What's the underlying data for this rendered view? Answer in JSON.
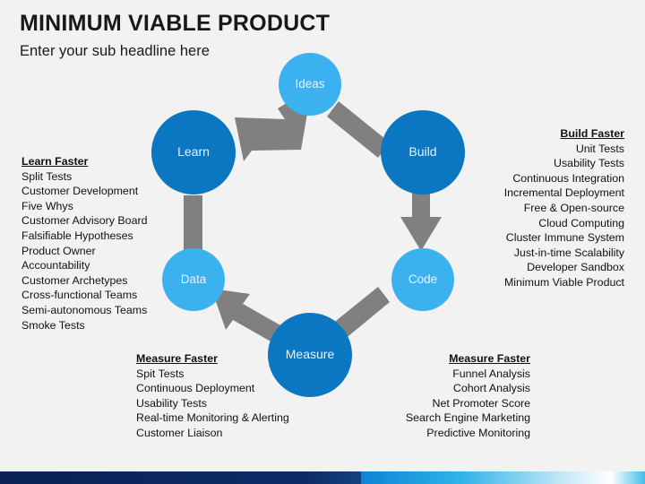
{
  "header": {
    "title": "MINIMUM VIABLE PRODUCT",
    "subtitle": "Enter your sub headline here"
  },
  "colors": {
    "background": "#f2f2f2",
    "node_dark": "#0b76c2",
    "node_light": "#3cb1ef",
    "arrow_gray": "#808080",
    "node_text": "#e8f4fd",
    "body_text": "#111111",
    "bar_navy": "#0a2256",
    "bar_blue": "#0c84d6"
  },
  "cycle": {
    "nodes": [
      {
        "id": "ideas",
        "label": "Ideas",
        "tone": "light",
        "size": 70
      },
      {
        "id": "build",
        "label": "Build",
        "tone": "dark",
        "size": 94
      },
      {
        "id": "code",
        "label": "Code",
        "tone": "light",
        "size": 70
      },
      {
        "id": "measure",
        "label": "Measure",
        "tone": "dark",
        "size": 94
      },
      {
        "id": "data",
        "label": "Data",
        "tone": "light",
        "size": 70
      },
      {
        "id": "learn",
        "label": "Learn",
        "tone": "dark",
        "size": 94
      }
    ],
    "connectors": [
      {
        "from": "ideas",
        "to": "build",
        "style": "bar"
      },
      {
        "from": "build",
        "to": "code",
        "style": "arrow"
      },
      {
        "from": "code",
        "to": "measure",
        "style": "bar"
      },
      {
        "from": "measure",
        "to": "data",
        "style": "arrow"
      },
      {
        "from": "data",
        "to": "learn",
        "style": "bar"
      },
      {
        "from": "learn",
        "to": "ideas",
        "style": "arrow"
      }
    ]
  },
  "blocks": {
    "learn": {
      "heading": "Learn Faster",
      "items": [
        "Split Tests",
        "Customer Development",
        "Five Whys",
        "Customer Advisory Board",
        "Falsifiable Hypotheses",
        "Product Owner",
        "Accountability",
        "Customer Archetypes",
        "Cross-functional Teams",
        "Semi-autonomous Teams",
        "Smoke Tests"
      ]
    },
    "build": {
      "heading": "Build Faster",
      "items": [
        "Unit Tests",
        "Usability Tests",
        "Continuous Integration",
        "Incremental Deployment",
        "Free & Open-source",
        "Cloud Computing",
        "Cluster Immune System",
        "Just-in-time Scalability",
        "Developer Sandbox",
        "Minimum Viable Product"
      ]
    },
    "measure_left": {
      "heading": "Measure Faster",
      "items": [
        "Spit Tests",
        "Continuous Deployment",
        "Usability Tests",
        "Real-time Monitoring & Alerting",
        "Customer Liaison"
      ]
    },
    "measure_right": {
      "heading": "Measure Faster",
      "items": [
        "Funnel Analysis",
        "Cohort Analysis",
        "Net Promoter Score",
        "Search Engine Marketing",
        "Predictive Monitoring"
      ]
    }
  }
}
